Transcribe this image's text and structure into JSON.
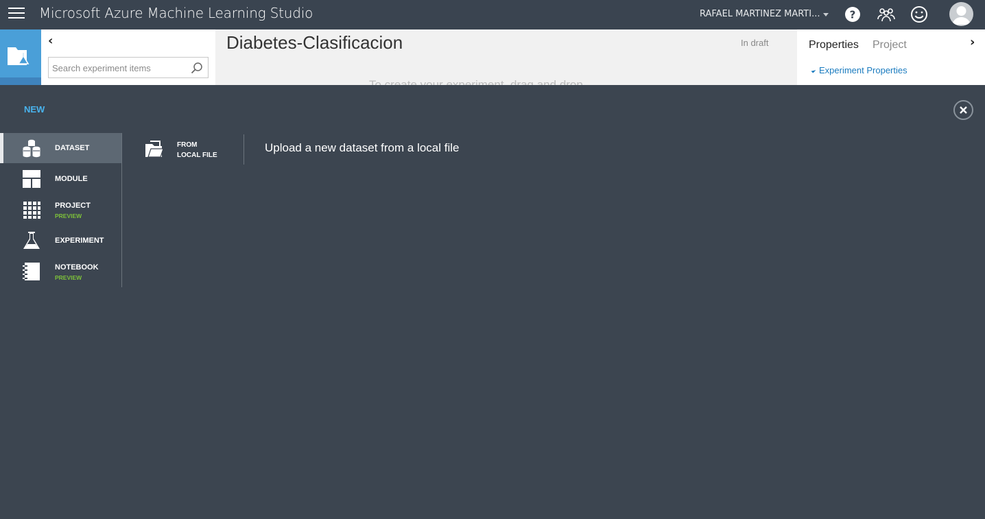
{
  "header": {
    "app_title": "Microsoft Azure Machine Learning Studio",
    "user_name": "RAFAEL MARTINEZ MARTI...",
    "icons": [
      "menu-icon",
      "help-icon",
      "community-icon",
      "feedback-smiley-icon",
      "user-avatar"
    ]
  },
  "palette": {
    "search_placeholder": "Search experiment items"
  },
  "canvas": {
    "experiment_title": "Diabetes-Clasificacion",
    "status": "In draft",
    "hint": "To create your experiment, drag and drop"
  },
  "properties_panel": {
    "tabs": [
      "Properties",
      "Project"
    ],
    "active_tab": "Properties",
    "section": "Experiment Properties"
  },
  "new_panel": {
    "heading": "NEW",
    "categories": [
      {
        "label": "DATASET",
        "sub": "",
        "icon": "dataset-icon",
        "active": true
      },
      {
        "label": "MODULE",
        "sub": "",
        "icon": "module-icon",
        "active": false
      },
      {
        "label": "PROJECT",
        "sub": "PREVIEW",
        "icon": "project-icon",
        "active": false
      },
      {
        "label": "EXPERIMENT",
        "sub": "",
        "icon": "experiment-flask-icon",
        "active": false
      },
      {
        "label": "NOTEBOOK",
        "sub": "PREVIEW",
        "icon": "notebook-icon",
        "active": false
      }
    ],
    "option": {
      "line1": "FROM",
      "line2": "LOCAL FILE",
      "icon": "folder-open-icon",
      "description": "Upload a new dataset from a local file"
    }
  },
  "colors": {
    "topbar": "#3a4450",
    "overlay": "#3c4550",
    "accent_blue": "#49b3ee",
    "preview_green": "#7dc13a",
    "link_blue": "#1a7bbf"
  }
}
